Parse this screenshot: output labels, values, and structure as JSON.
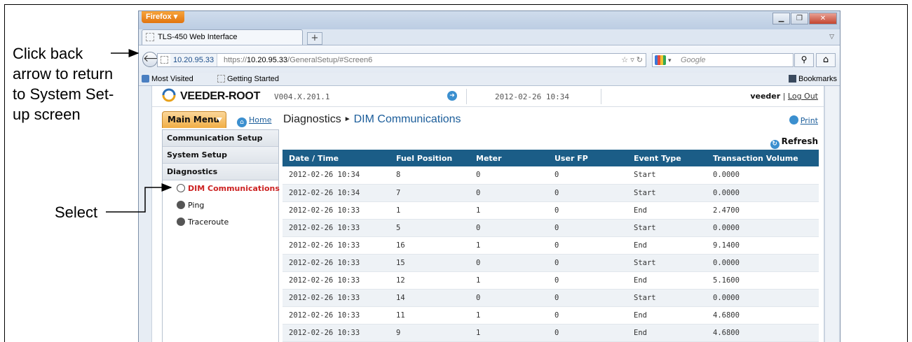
{
  "annotations": {
    "back_lines": [
      "Click back",
      "arrow to return",
      "to System Set-",
      "up screen"
    ],
    "select": "Select"
  },
  "browser": {
    "app_button": "Firefox",
    "tab_title": "TLS-450 Web Interface",
    "url_identity": "10.20.95.33",
    "url_prefix": "https://",
    "url_host": "10.20.95.33",
    "url_path": "/GeneralSetup/#Screen6",
    "search_placeholder": "Google",
    "bookmarks": [
      "Most Visited",
      "Getting Started"
    ],
    "bookmarks_menu": "Bookmarks"
  },
  "app": {
    "brand": "VEEDER-ROOT",
    "version": "V004.X.201.1",
    "datetime": "2012-02-26 10:34",
    "username": "veeder",
    "logout": "Log Out",
    "main_menu": "Main Menu",
    "home": "Home",
    "breadcrumb_section": "Diagnostics",
    "breadcrumb_current": "DIM Communications",
    "print": "Print",
    "refresh": "Refresh"
  },
  "sidebar": {
    "sections": [
      "Communication Setup",
      "System Setup",
      "Diagnostics"
    ],
    "items": [
      {
        "label": "DIM Communications",
        "active": true
      },
      {
        "label": "Ping",
        "active": false
      },
      {
        "label": "Traceroute",
        "active": false
      }
    ]
  },
  "table": {
    "columns": [
      "Date / Time",
      "Fuel Position",
      "Meter",
      "User FP",
      "Event Type",
      "Transaction Volume"
    ],
    "rows": [
      [
        "2012-02-26 10:34",
        "8",
        "0",
        "0",
        "Start",
        "0.0000"
      ],
      [
        "2012-02-26 10:34",
        "7",
        "0",
        "0",
        "Start",
        "0.0000"
      ],
      [
        "2012-02-26 10:33",
        "1",
        "1",
        "0",
        "End",
        "2.4700"
      ],
      [
        "2012-02-26 10:33",
        "5",
        "0",
        "0",
        "Start",
        "0.0000"
      ],
      [
        "2012-02-26 10:33",
        "16",
        "1",
        "0",
        "End",
        "9.1400"
      ],
      [
        "2012-02-26 10:33",
        "15",
        "0",
        "0",
        "Start",
        "0.0000"
      ],
      [
        "2012-02-26 10:33",
        "12",
        "1",
        "0",
        "End",
        "5.1600"
      ],
      [
        "2012-02-26 10:33",
        "14",
        "0",
        "0",
        "Start",
        "0.0000"
      ],
      [
        "2012-02-26 10:33",
        "11",
        "1",
        "0",
        "End",
        "4.6800"
      ],
      [
        "2012-02-26 10:33",
        "9",
        "1",
        "0",
        "End",
        "4.6800"
      ]
    ]
  },
  "colors": {
    "table_header": "#1b5d87",
    "main_menu": "#f1ae45",
    "active_item": "#cc2222"
  }
}
